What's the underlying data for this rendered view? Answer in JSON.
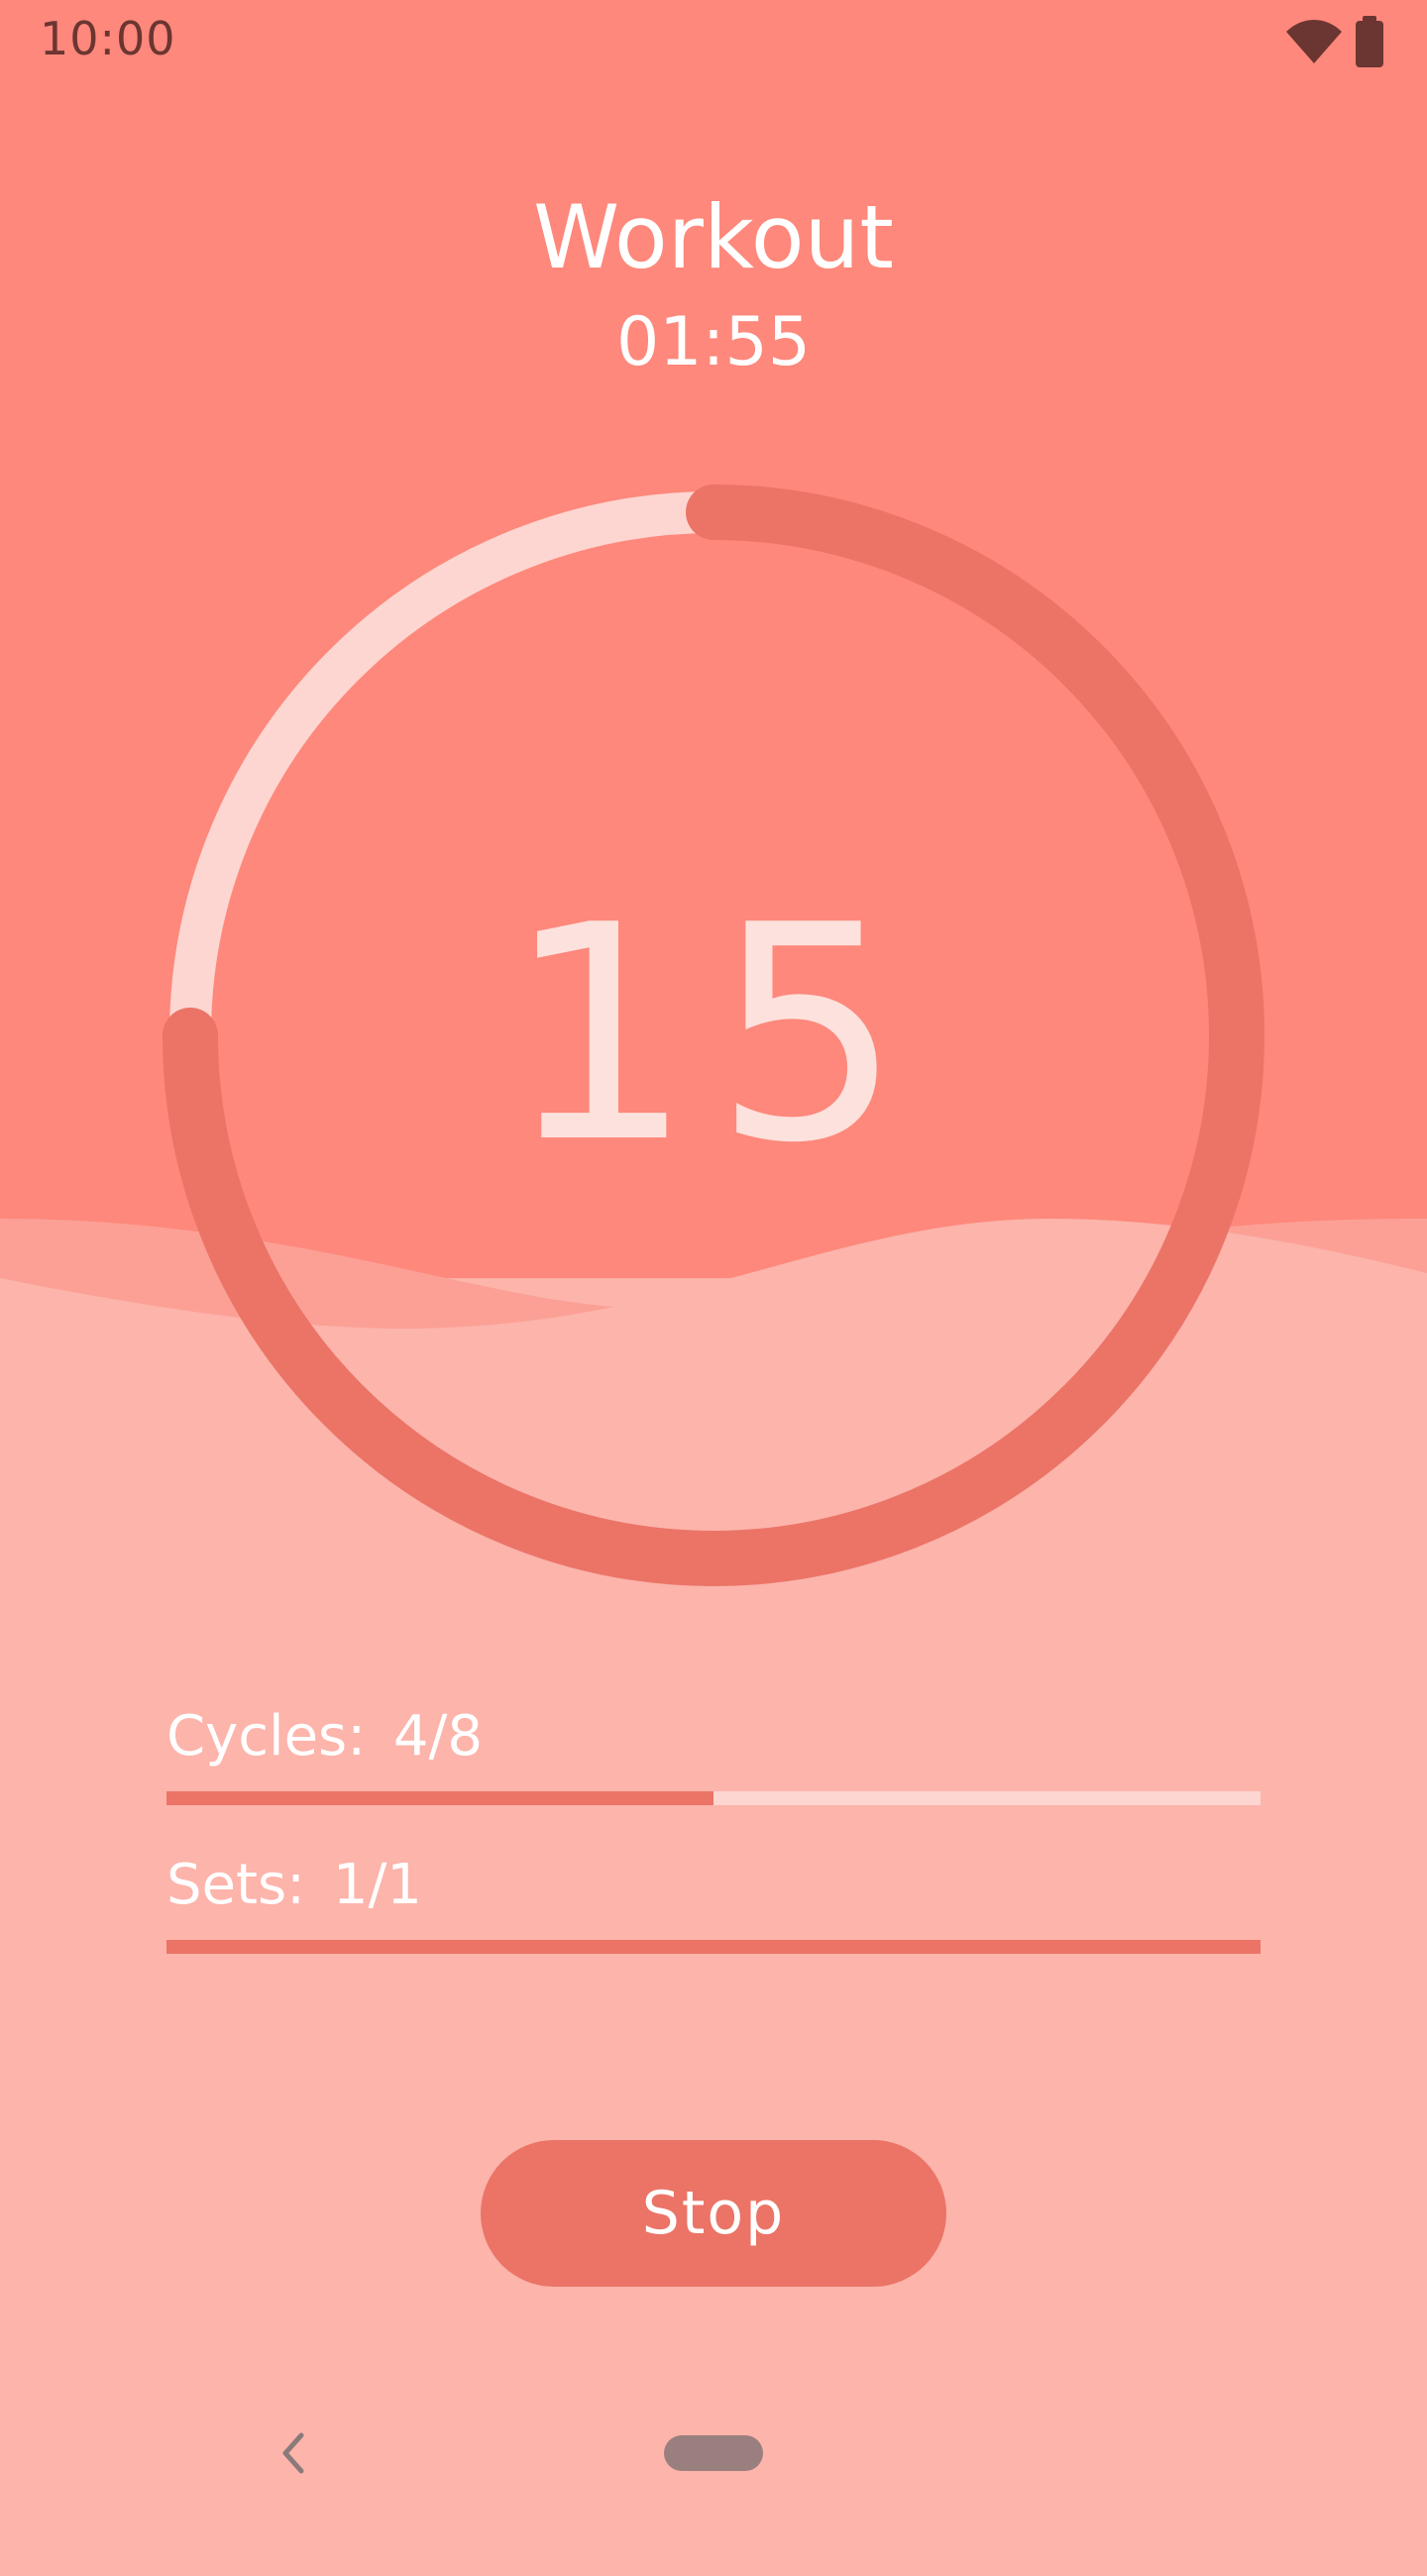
{
  "status_bar": {
    "time": "10:00"
  },
  "header": {
    "title": "Workout",
    "timer": "01:55"
  },
  "countdown": {
    "value": "15",
    "ring_progress": 0.75
  },
  "progress": {
    "cycles": {
      "label": "Cycles:",
      "value": "4/8",
      "fraction": 0.5
    },
    "sets": {
      "label": "Sets:",
      "value": "1/1",
      "fraction": 1.0
    }
  },
  "actions": {
    "stop_label": "Stop"
  },
  "colors": {
    "background_top": "#fd887b",
    "background_bottom": "#fcb4ab",
    "accent": "#eb7467",
    "track": "#fdd6d1",
    "text": "#ffffff"
  },
  "icons": [
    "wifi-icon",
    "battery-icon",
    "back-icon",
    "home-pill"
  ]
}
